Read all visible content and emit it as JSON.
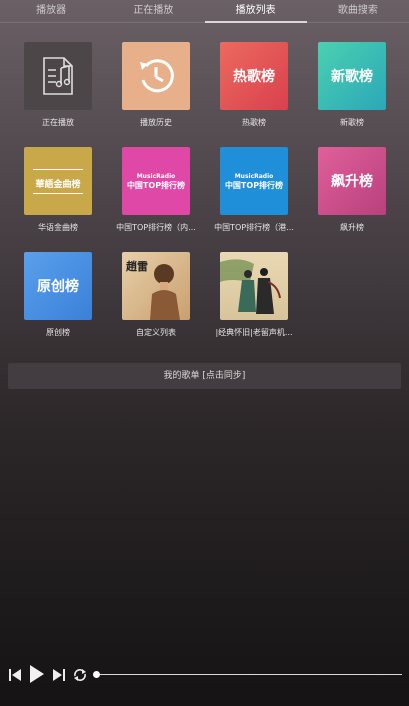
{
  "tabs": [
    {
      "label": "播放器"
    },
    {
      "label": "正在播放"
    },
    {
      "label": "播放列表"
    },
    {
      "label": "歌曲搜索"
    }
  ],
  "active_tab": 2,
  "playlists": [
    {
      "caption": "正在播放",
      "cover_text": ""
    },
    {
      "caption": "播放历史",
      "cover_text": ""
    },
    {
      "caption": "热歌榜",
      "cover_text": "热歌榜"
    },
    {
      "caption": "新歌榜",
      "cover_text": "新歌榜"
    },
    {
      "caption": "华语金曲榜",
      "cover_text": "華語金曲榜"
    },
    {
      "caption": "中国TOP排行榜（内...",
      "cover_brand": "MusicRadio",
      "cover_text": "中国TOP排行榜"
    },
    {
      "caption": "中国TOP排行榜（港...",
      "cover_brand": "MusicRadio",
      "cover_text": "中国TOP排行榜"
    },
    {
      "caption": "飙升榜",
      "cover_text": "飙升榜"
    },
    {
      "caption": "原创榜",
      "cover_text": "原创榜"
    },
    {
      "caption": "自定义列表",
      "cover_text": "趙雷"
    },
    {
      "caption": "|经典怀旧|老留声机...",
      "cover_text": ""
    }
  ],
  "sync_label": "我的歌单 [点击同步]",
  "player": {
    "progress": 0
  },
  "colors": {
    "hot": "#e0505a",
    "new": "#3cc0a8",
    "gold": "#c9a84a",
    "mainland_top": "#e048a8",
    "hk_top": "#1e8fd8",
    "rising": "#c84a8a",
    "original": "#4a90e2"
  }
}
